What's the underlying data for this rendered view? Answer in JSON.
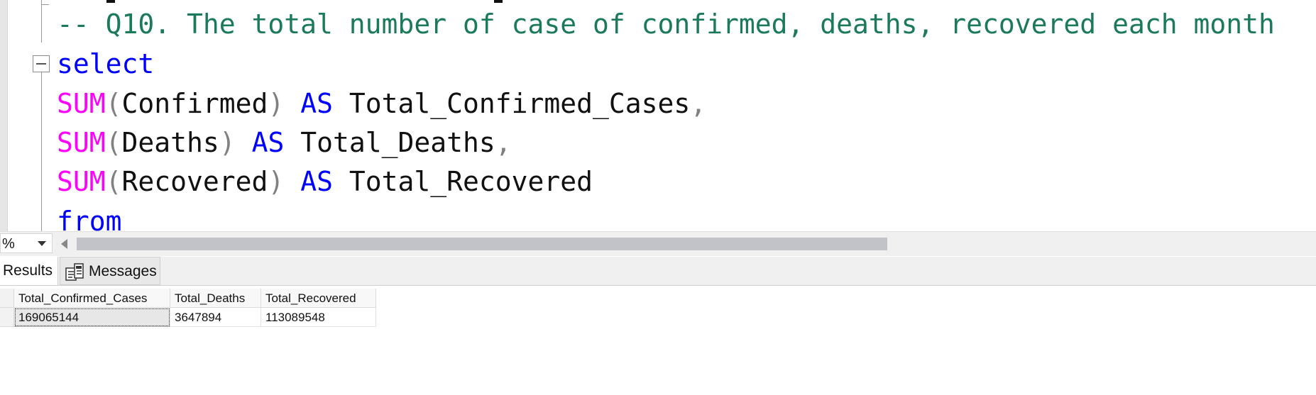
{
  "editor": {
    "lines": {
      "comment": "-- Q10. The total number of case of confirmed, deaths, recovered each month",
      "select": "select",
      "l3": {
        "fn": "SUM",
        "open": "(",
        "arg": "Confirmed",
        "close": ")",
        "as": "AS",
        "alias": "Total_Confirmed_Cases",
        "comma": ","
      },
      "l4": {
        "fn": "SUM",
        "open": "(",
        "arg": "Deaths",
        "close": ")",
        "as": "AS",
        "alias": "Total_Deaths",
        "comma": ","
      },
      "l5": {
        "fn": "SUM",
        "open": "(",
        "arg": "Recovered",
        "close": ")",
        "as": "AS",
        "alias": "Total_Recovered"
      },
      "from": "from"
    },
    "colors": {
      "keyword": "#0000ff",
      "function": "#ff00ff",
      "comment": "#1a7a5a",
      "punctuation": "#808080"
    }
  },
  "status": {
    "zoom_value": "%"
  },
  "tabs": {
    "results": "Results",
    "messages": "Messages"
  },
  "grid": {
    "columns": [
      "Total_Confirmed_Cases",
      "Total_Deaths",
      "Total_Recovered"
    ],
    "rows": [
      [
        "169065144",
        "3647894",
        "113089548"
      ]
    ]
  }
}
